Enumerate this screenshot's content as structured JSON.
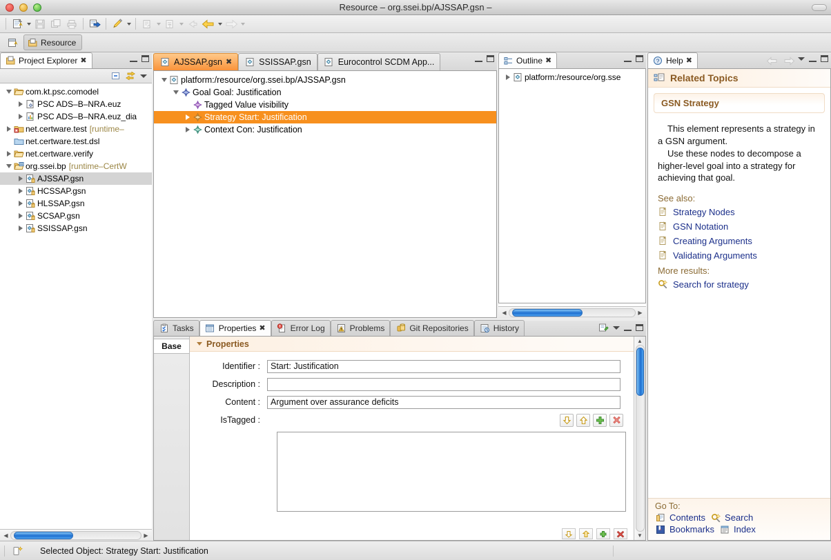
{
  "window": {
    "title": "Resource – org.ssei.bp/AJSSAP.gsn –"
  },
  "toolbar": {
    "items": [
      {
        "name": "new-wizard",
        "icon": "new-file-icon",
        "has_dropdown": true,
        "enabled": true
      },
      {
        "name": "save",
        "icon": "save-icon",
        "has_dropdown": false,
        "enabled": false
      },
      {
        "name": "save-all",
        "icon": "save-all-icon",
        "has_dropdown": false,
        "enabled": false
      },
      {
        "name": "print",
        "icon": "print-icon",
        "has_dropdown": false,
        "enabled": false
      },
      {
        "name": "export",
        "icon": "export-icon",
        "has_dropdown": false,
        "enabled": true
      },
      {
        "name": "annotate",
        "icon": "pen-icon",
        "has_dropdown": true,
        "enabled": true
      },
      {
        "name": "validate",
        "icon": "validate-icon",
        "has_dropdown": true,
        "enabled": false
      },
      {
        "name": "open-type",
        "icon": "open-type-icon",
        "has_dropdown": true,
        "enabled": false
      },
      {
        "name": "back",
        "icon": "back-arrow-icon",
        "has_dropdown": false,
        "enabled": false
      },
      {
        "name": "previous",
        "icon": "previous-arrow-icon",
        "has_dropdown": true,
        "enabled": true
      },
      {
        "name": "forward",
        "icon": "forward-arrow-icon",
        "has_dropdown": true,
        "enabled": false
      }
    ]
  },
  "perspective": {
    "open_label": "",
    "current": "Resource"
  },
  "project_explorer": {
    "tab_label": "Project Explorer",
    "toolbar": [
      "collapse-all-icon",
      "link-with-editor-icon",
      "view-menu-icon"
    ],
    "tree": [
      {
        "label": "com.kt.psc.comodel",
        "indent": 0,
        "twist": "open",
        "icon": "folder-open-icon",
        "suffix": "",
        "selected": false
      },
      {
        "label": "PSC ADS–B–NRA.euz",
        "indent": 1,
        "twist": "closed",
        "icon": "model-file-icon",
        "suffix": "",
        "selected": false
      },
      {
        "label": "PSC ADS–B–NRA.euz_dia",
        "indent": 1,
        "twist": "closed",
        "icon": "diagram-file-icon",
        "suffix": "",
        "selected": false
      },
      {
        "label": "net.certware.test",
        "indent": 0,
        "twist": "closed",
        "icon": "project-error-icon",
        "suffix": "[runtime–",
        "selected": false
      },
      {
        "label": "net.certware.test.dsl",
        "indent": 0,
        "twist": "none",
        "icon": "folder-closed-icon",
        "suffix": "",
        "selected": false
      },
      {
        "label": "net.certware.verify",
        "indent": 0,
        "twist": "closed",
        "icon": "folder-open-icon",
        "suffix": "",
        "selected": false
      },
      {
        "label": "org.ssei.bp",
        "indent": 0,
        "twist": "open",
        "icon": "project-icon",
        "suffix": "[runtime–CertW",
        "selected": false
      },
      {
        "label": "AJSSAP.gsn",
        "indent": 1,
        "twist": "closed",
        "icon": "gsn-file-icon",
        "suffix": "",
        "selected": true
      },
      {
        "label": "HCSSAP.gsn",
        "indent": 1,
        "twist": "closed",
        "icon": "gsn-file-icon",
        "suffix": "",
        "selected": false
      },
      {
        "label": "HLSSAP.gsn",
        "indent": 1,
        "twist": "closed",
        "icon": "gsn-file-icon",
        "suffix": "",
        "selected": false
      },
      {
        "label": "SCSAP.gsn",
        "indent": 1,
        "twist": "closed",
        "icon": "gsn-file-icon",
        "suffix": "",
        "selected": false
      },
      {
        "label": "SSISSAP.gsn",
        "indent": 1,
        "twist": "closed",
        "icon": "gsn-file-icon",
        "suffix": "",
        "selected": false
      }
    ]
  },
  "editor": {
    "tabs": [
      {
        "label": "AJSSAP.gsn",
        "active": true,
        "closable": true
      },
      {
        "label": "SSISSAP.gsn",
        "active": false,
        "closable": false
      },
      {
        "label": "Eurocontrol SCDM App...",
        "active": false,
        "closable": false
      }
    ],
    "tree": [
      {
        "label": "platform:/resource/org.ssei.bp/AJSSAP.gsn",
        "indent": 0,
        "twist": "open",
        "icon": "gsn-root-icon",
        "selected": false
      },
      {
        "label": "Goal Goal: Justification",
        "indent": 1,
        "twist": "open",
        "icon": "goal-node-icon",
        "selected": false
      },
      {
        "label": "Tagged Value visibility",
        "indent": 2,
        "twist": "none",
        "icon": "tagged-value-icon",
        "selected": false
      },
      {
        "label": "Strategy Start: Justification",
        "indent": 2,
        "twist": "closed",
        "icon": "strategy-node-icon",
        "selected": true
      },
      {
        "label": "Context Con: Justification",
        "indent": 2,
        "twist": "closed",
        "icon": "context-node-icon",
        "selected": false
      }
    ]
  },
  "outline": {
    "tab_label": "Outline",
    "tree": [
      {
        "label": "platform:/resource/org.sse",
        "indent": 0,
        "twist": "closed",
        "icon": "gsn-root-icon"
      }
    ]
  },
  "properties_panel": {
    "tabs": [
      {
        "label": "Tasks",
        "icon": "tasks-icon",
        "active": false,
        "closable": false
      },
      {
        "label": "Properties",
        "icon": "properties-icon",
        "active": true,
        "closable": true
      },
      {
        "label": "Error Log",
        "icon": "error-log-icon",
        "active": false,
        "closable": false
      },
      {
        "label": "Problems",
        "icon": "problems-icon",
        "active": false,
        "closable": false
      },
      {
        "label": "Git Repositories",
        "icon": "git-icon",
        "active": false,
        "closable": false
      },
      {
        "label": "History",
        "icon": "history-icon",
        "active": false,
        "closable": false
      }
    ],
    "side_tab": "Base",
    "section_title": "Properties",
    "fields": [
      {
        "label": "Identifier :",
        "value": "Start: Justification"
      },
      {
        "label": "Description :",
        "value": ""
      },
      {
        "label": "Content :",
        "value": "Argument over assurance deficits"
      }
    ],
    "list_field_label": "IsTagged :",
    "list_buttons": [
      "move-down-icon",
      "move-up-icon",
      "add-icon",
      "delete-icon"
    ],
    "bottom_buttons": [
      "move-down-icon",
      "move-up-icon",
      "add-icon",
      "delete-icon"
    ]
  },
  "help": {
    "tab_label": "Help",
    "header": "Related Topics",
    "topic_title": "GSN Strategy",
    "paragraphs": [
      "This element represents a strategy in a GSN argument.",
      "Use these nodes to decompose a higher-level goal into a strategy for achieving that goal."
    ],
    "see_also_label": "See also:",
    "see_also": [
      {
        "label": "Strategy Nodes",
        "icon": "doc-icon"
      },
      {
        "label": "GSN Notation",
        "icon": "doc-icon"
      },
      {
        "label": "Creating Arguments",
        "icon": "doc-icon"
      },
      {
        "label": "Validating Arguments",
        "icon": "doc-icon"
      }
    ],
    "more_results_label": "More results:",
    "more_results": [
      {
        "label": "Search for strategy",
        "icon": "search-icon"
      }
    ],
    "goto_label": "Go To:",
    "goto_items": [
      {
        "label": "Contents",
        "icon": "contents-icon"
      },
      {
        "label": "Search",
        "icon": "search-icon"
      },
      {
        "label": "Bookmarks",
        "icon": "bookmarks-icon"
      },
      {
        "label": "Index",
        "icon": "index-icon"
      }
    ]
  },
  "statusbar": {
    "text": "Selected Object: Strategy Start: Justification",
    "icon": "selected-object-icon"
  },
  "colors": {
    "selection_orange": "#f7901e",
    "tab_active_orange": "#f9933a",
    "scrollbar_blue": "#1e6fd0",
    "link_blue": "#1b2f8a",
    "heading_brown": "#8a5a22"
  }
}
